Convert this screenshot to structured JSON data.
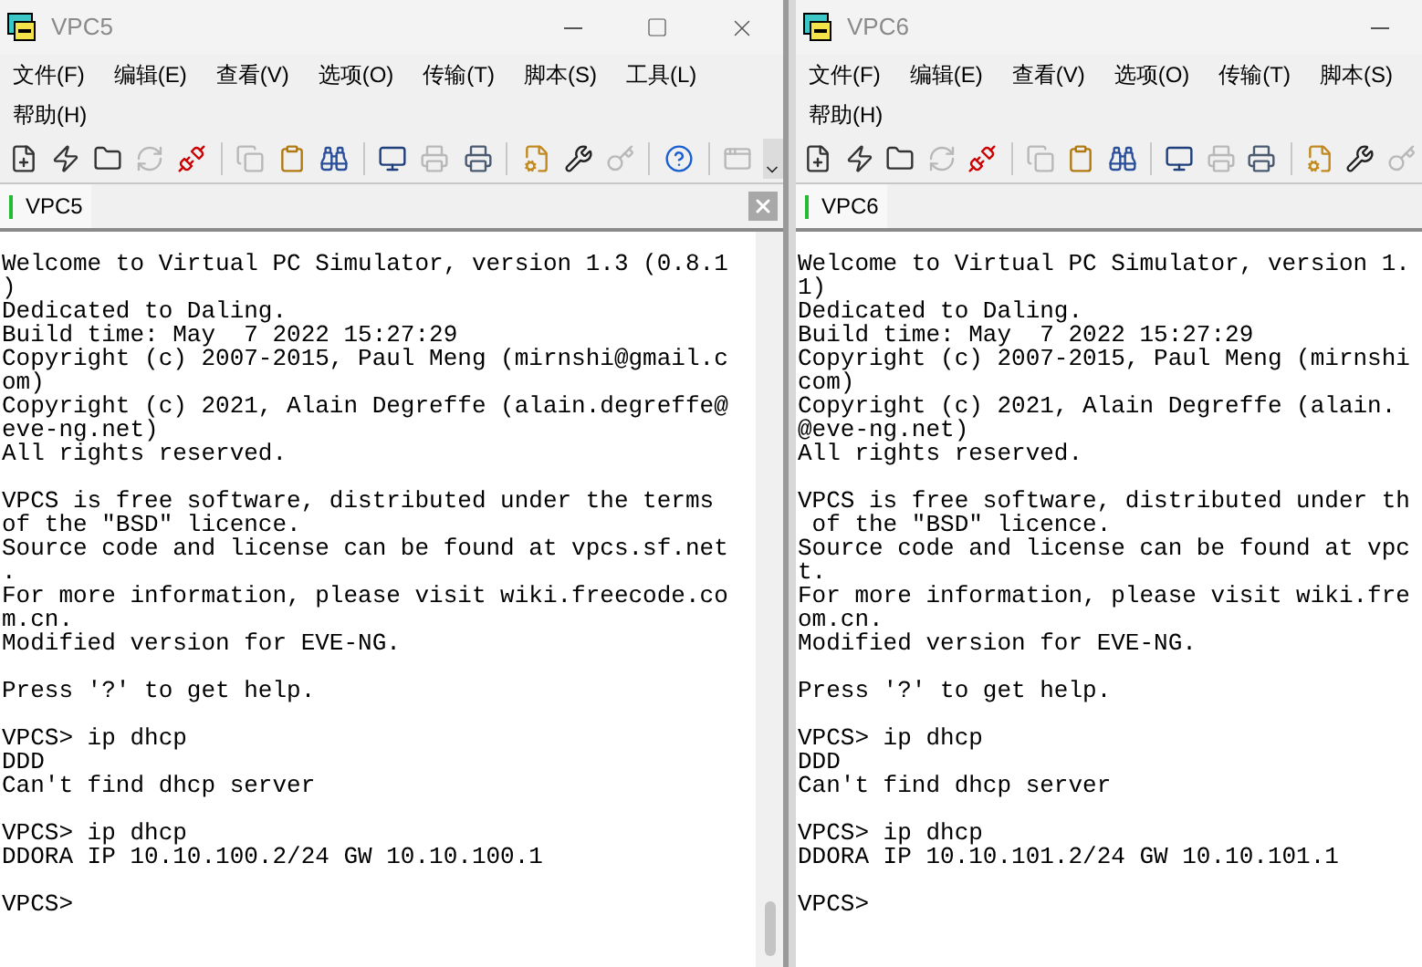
{
  "windows": [
    {
      "title": "VPC5",
      "window_buttons": [
        {
          "kind": "minimize"
        },
        {
          "kind": "maximize"
        },
        {
          "kind": "close"
        }
      ],
      "menu": [
        "文件(F)",
        "编辑(E)",
        "查看(V)",
        "选项(O)",
        "传输(T)",
        "脚本(S)",
        "工具(L)",
        "帮助(H)"
      ],
      "toolbar": [
        [
          {
            "kind": "new",
            "disabled": false
          },
          {
            "kind": "connect",
            "disabled": false
          },
          {
            "kind": "folder",
            "disabled": false
          },
          {
            "kind": "reconnect",
            "disabled": true
          },
          {
            "kind": "disconnect",
            "disabled": false
          }
        ],
        [
          {
            "kind": "copy",
            "disabled": true
          },
          {
            "kind": "paste",
            "disabled": false
          },
          {
            "kind": "find",
            "disabled": false
          }
        ],
        [
          {
            "kind": "screen",
            "disabled": false
          },
          {
            "kind": "print-preview",
            "disabled": true
          },
          {
            "kind": "print",
            "disabled": false
          }
        ],
        [
          {
            "kind": "properties",
            "disabled": false
          },
          {
            "kind": "tools",
            "disabled": false
          },
          {
            "kind": "key",
            "disabled": true
          }
        ],
        [
          {
            "kind": "help",
            "disabled": false
          }
        ],
        [
          {
            "kind": "window",
            "disabled": true
          }
        ]
      ],
      "toolbar_overflow": true,
      "tabs": [
        {
          "label": "VPC5",
          "selected": true
        }
      ],
      "tab_close": true,
      "scrollbar": true,
      "terminal": [
        [
          "Welcome to Virtual PC Simulator, version 1.3 (0.8.1",
          ")",
          "Dedicated to Daling.",
          "Build time: May  7 2022 15:27:29",
          "Copyright (c) 2007-2015, Paul Meng (mirnshi@gmail.c",
          "om)",
          "Copyright (c) 2021, Alain Degreffe (alain.degreffe@",
          "eve-ng.net)",
          "All rights reserved."
        ],
        [
          "VPCS is free software, distributed under the terms",
          "of the \"BSD\" licence.",
          "Source code and license can be found at vpcs.sf.net",
          ".",
          "For more information, please visit wiki.freecode.co",
          "m.cn.",
          "Modified version for EVE-NG."
        ],
        [
          "Press '?' to get help."
        ],
        [
          "VPCS> ip dhcp",
          "DDD",
          "Can't find dhcp server"
        ],
        [
          "VPCS> ip dhcp",
          "DDORA IP 10.10.100.2/24 GW 10.10.100.1"
        ],
        [
          "VPCS>"
        ]
      ]
    },
    {
      "title": "VPC6",
      "window_buttons": [
        {
          "kind": "minimize"
        }
      ],
      "menu": [
        "文件(F)",
        "编辑(E)",
        "查看(V)",
        "选项(O)",
        "传输(T)",
        "脚本(S)",
        "帮助(H)"
      ],
      "toolbar": [
        [
          {
            "kind": "new",
            "disabled": false
          },
          {
            "kind": "connect",
            "disabled": false
          },
          {
            "kind": "folder",
            "disabled": false
          },
          {
            "kind": "reconnect",
            "disabled": true
          },
          {
            "kind": "disconnect",
            "disabled": false
          }
        ],
        [
          {
            "kind": "copy",
            "disabled": true
          },
          {
            "kind": "paste",
            "disabled": false
          },
          {
            "kind": "find",
            "disabled": false
          }
        ],
        [
          {
            "kind": "screen",
            "disabled": false
          },
          {
            "kind": "print-preview",
            "disabled": true
          },
          {
            "kind": "print",
            "disabled": false
          }
        ],
        [
          {
            "kind": "properties",
            "disabled": false
          },
          {
            "kind": "tools",
            "disabled": false
          },
          {
            "kind": "key",
            "disabled": true
          }
        ]
      ],
      "tabs": [
        {
          "label": "VPC6",
          "selected": true
        }
      ],
      "terminal": [
        [
          "Welcome to Virtual PC Simulator, version 1.",
          "1)",
          "Dedicated to Daling.",
          "Build time: May  7 2022 15:27:29",
          "Copyright (c) 2007-2015, Paul Meng (mirnshi",
          "com)",
          "Copyright (c) 2021, Alain Degreffe (alain.",
          "@eve-ng.net)",
          "All rights reserved."
        ],
        [
          "VPCS is free software, distributed under th",
          " of the \"BSD\" licence.",
          "Source code and license can be found at vpc",
          "t.",
          "For more information, please visit wiki.fre",
          "om.cn.",
          "Modified version for EVE-NG."
        ],
        [
          "Press '?' to get help."
        ],
        [
          "VPCS> ip dhcp",
          "DDD",
          "Can't find dhcp server"
        ],
        [
          "VPCS> ip dhcp",
          "DDORA IP 10.10.101.2/24 GW 10.10.101.1"
        ],
        [
          "VPCS>"
        ]
      ]
    }
  ]
}
